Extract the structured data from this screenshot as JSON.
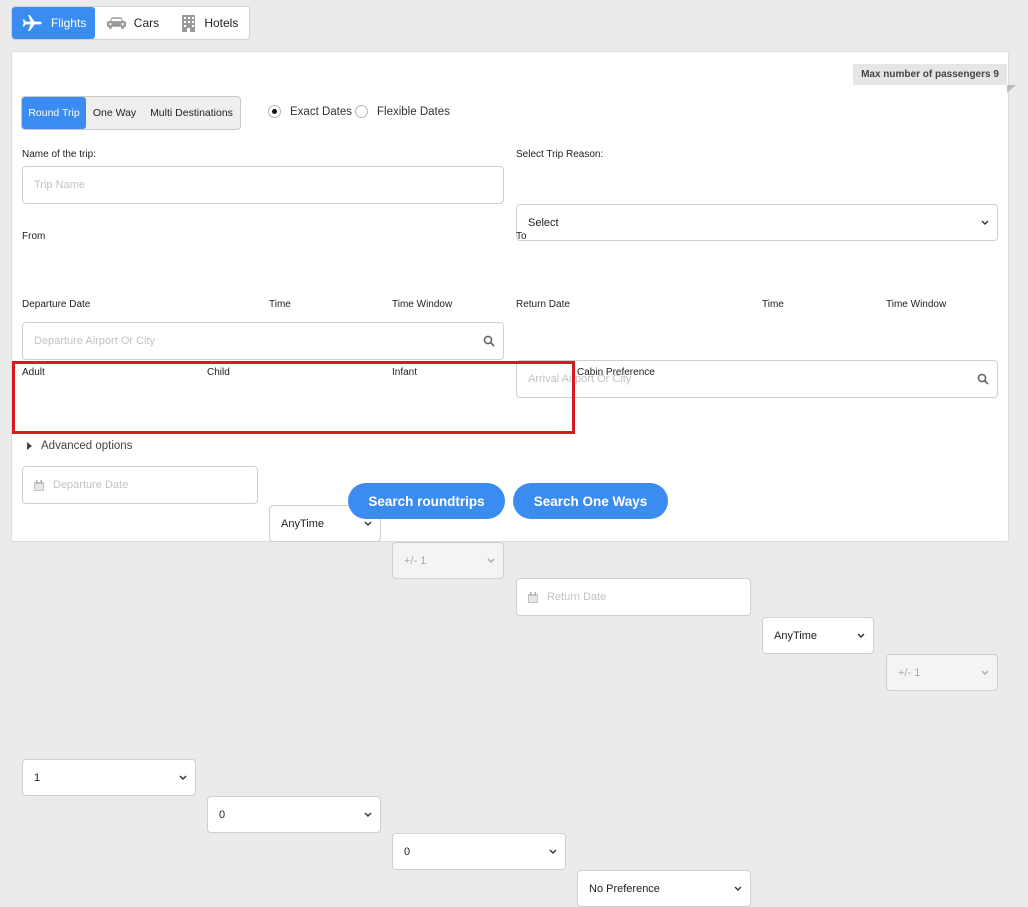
{
  "services": [
    {
      "label": "Flights",
      "icon": "plane-icon",
      "active": true
    },
    {
      "label": "Cars",
      "icon": "car-icon",
      "active": false
    },
    {
      "label": "Hotels",
      "icon": "hotel-icon",
      "active": false
    }
  ],
  "max_passengers_label": "Max number of passengers 9",
  "trip_types": [
    "Round Trip",
    "One Way",
    "Multi Destinations"
  ],
  "date_mode": {
    "exact": "Exact Dates",
    "flexible": "Flexible Dates",
    "selected": "exact"
  },
  "trip_name": {
    "label": "Name of the trip:",
    "placeholder": "Trip Name"
  },
  "trip_reason": {
    "label": "Select Trip Reason:",
    "value": "Select"
  },
  "from": {
    "label": "From",
    "placeholder": "Departure Airport Or City"
  },
  "to": {
    "label": "To",
    "placeholder": "Arrival Airport Or City"
  },
  "departure": {
    "date_label": "Departure Date",
    "date_placeholder": "Departure Date",
    "time_label": "Time",
    "time_value": "AnyTime",
    "window_label": "Time Window",
    "window_value": "+/- 1"
  },
  "return": {
    "date_label": "Return Date",
    "date_placeholder": "Return Date",
    "time_label": "Time",
    "time_value": "AnyTime",
    "window_label": "Time Window",
    "window_value": "+/- 1"
  },
  "passengers": {
    "adult_label": "Adult",
    "adult_value": "1",
    "child_label": "Child",
    "child_value": "0",
    "infant_label": "Infant",
    "infant_value": "0"
  },
  "cabin": {
    "label": "Cabin Preference",
    "value": "No Preference"
  },
  "advanced_label": "Advanced options",
  "buttons": {
    "search_roundtrips": "Search roundtrips",
    "search_one_ways": "Search One Ways"
  },
  "colors": {
    "accent": "#3b8cf0",
    "highlight": "#d71920"
  }
}
